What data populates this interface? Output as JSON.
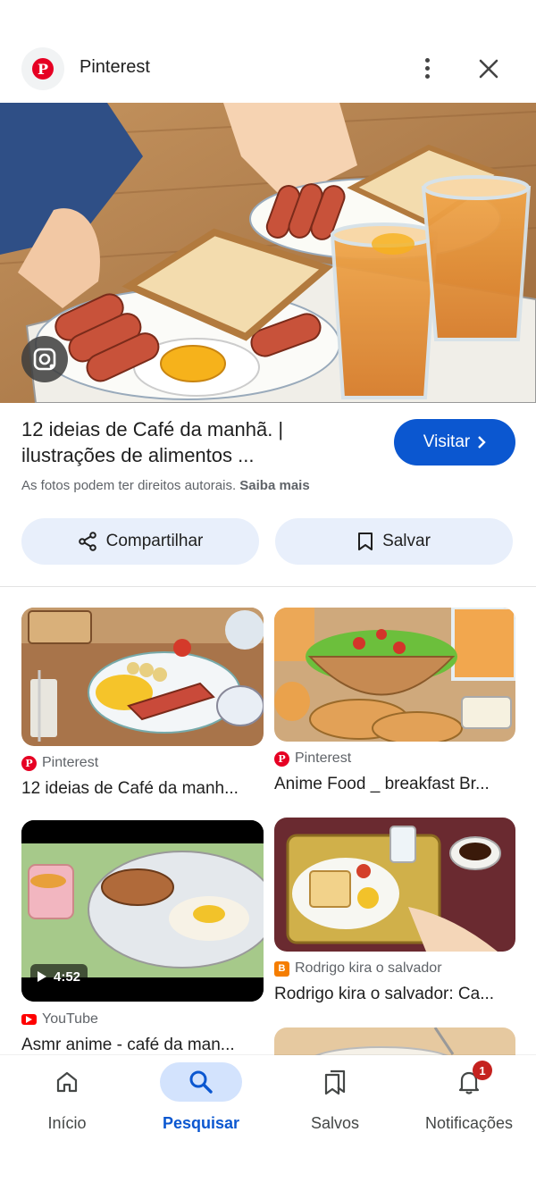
{
  "header": {
    "source_name": "Pinterest",
    "logo_letter": "P"
  },
  "result": {
    "title": "12 ideias de Café da manhã. | ilustrações de alimentos ...",
    "visit_label": "Visitar",
    "copyright_text": "As fotos podem ter direitos autorais.",
    "learn_more": "Saiba mais",
    "share_label": "Compartilhar",
    "save_label": "Salvar"
  },
  "related": [
    {
      "source": "Pinterest",
      "source_icon": "pinterest-icon",
      "title": "12 ideias de Café da manh..."
    },
    {
      "source": "Pinterest",
      "source_icon": "pinterest-icon",
      "title": "Anime Food _ breakfast Br..."
    },
    {
      "source": "YouTube",
      "source_icon": "youtube-icon",
      "title": "Asmr anime - café da man...",
      "duration": "4:52"
    },
    {
      "source": "Rodrigo kira o salvador",
      "source_icon": "blogger-icon",
      "title": "Rodrigo kira o salvador: Ca..."
    }
  ],
  "nav": {
    "items": [
      {
        "label": "Início",
        "icon": "home-icon"
      },
      {
        "label": "Pesquisar",
        "icon": "search-icon"
      },
      {
        "label": "Salvos",
        "icon": "bookmarks-icon"
      },
      {
        "label": "Notificações",
        "icon": "bell-icon"
      }
    ],
    "active": "Pesquisar",
    "notification_count": "1"
  },
  "colors": {
    "accent": "#0b57d0",
    "pill_bg": "#e8effb",
    "pinterest": "#e60023",
    "badge": "#c5221f"
  }
}
